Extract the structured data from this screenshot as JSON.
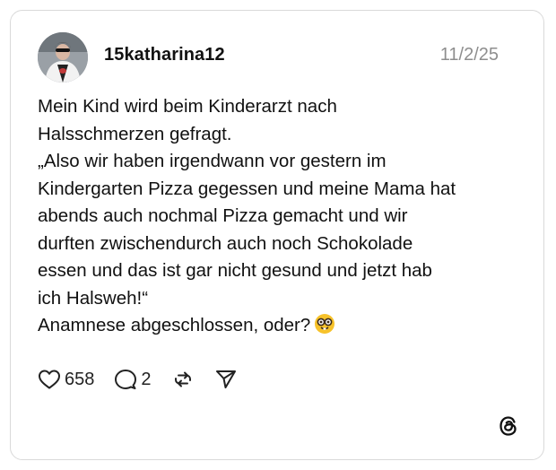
{
  "post": {
    "username": "15katharina12",
    "date": "11/2/25",
    "lines": [
      "Mein Kind wird beim Kinderarzt nach",
      "Halsschmerzen gefragt.",
      "„Also wir haben irgendwann vor gestern im",
      "Kindergarten Pizza gegessen und meine Mama hat",
      "abends auch nochmal Pizza gemacht und wir",
      "durften zwischendurch auch noch Schokolade",
      "essen und das ist gar nicht gesund und jetzt hab",
      "ich Halsweh!“",
      "Anamnese abgeschlossen, oder?"
    ],
    "emoji": "nerd-face-emoji"
  },
  "actions": {
    "like_count": "658",
    "reply_count": "2"
  },
  "icons": {
    "like": "heart-icon",
    "reply": "speech-bubble-icon",
    "repost": "repost-icon",
    "share": "send-icon",
    "brand": "threads-logo-icon"
  },
  "colors": {
    "text": "#111111",
    "date": "#8e8e8e",
    "border": "#d9d9d9",
    "emoji_face": "#f7c22a"
  }
}
